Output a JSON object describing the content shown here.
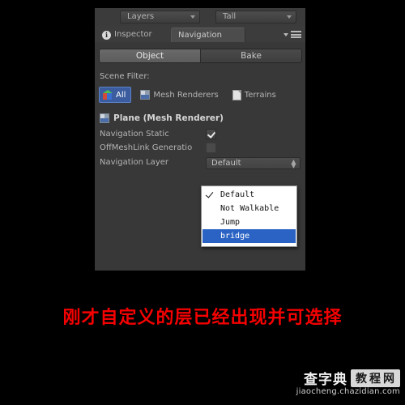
{
  "window": {
    "background": "#000000",
    "panel_bg": "#383838"
  },
  "toolbar": {
    "layers_label": "Layers",
    "tall_label": "Tall"
  },
  "tabs": {
    "inspector_label": "Inspector",
    "inspector_badge": "i",
    "navigation_label": "Navigation"
  },
  "mode_tabs": {
    "object_label": "Object",
    "bake_label": "Bake",
    "active": "Object"
  },
  "scene_filter": {
    "title": "Scene Filter:",
    "items": [
      {
        "label": "All",
        "icon": "cube-icon",
        "active": true
      },
      {
        "label": "Mesh Renderers",
        "icon": "mesh-renderer-icon",
        "active": false
      },
      {
        "label": "Terrains",
        "icon": "terrain-icon",
        "active": false
      }
    ]
  },
  "object": {
    "header": "Plane (Mesh Renderer)",
    "header_icon": "mesh-renderer-icon",
    "properties": [
      {
        "label": "Navigation Static",
        "type": "checkbox",
        "checked": true
      },
      {
        "label": "OffMeshLink Generatio",
        "type": "checkbox",
        "checked": false
      },
      {
        "label": "Navigation Layer",
        "type": "popup",
        "value": "Default"
      }
    ]
  },
  "layer_popup": {
    "options": [
      {
        "label": "Default",
        "checked": true,
        "highlighted": false
      },
      {
        "label": "Not Walkable",
        "checked": false,
        "highlighted": false
      },
      {
        "label": "Jump",
        "checked": false,
        "highlighted": false
      },
      {
        "label": "bridge",
        "checked": false,
        "highlighted": true
      }
    ],
    "highlight_color": "#2a63c4"
  },
  "caption": {
    "text": "刚才自定义的层已经出现并可选择",
    "color": "#f50000"
  },
  "watermark": {
    "brand": "查字典",
    "brand_tag": "教程网",
    "url": "jiaocheng.chazidian.com"
  }
}
